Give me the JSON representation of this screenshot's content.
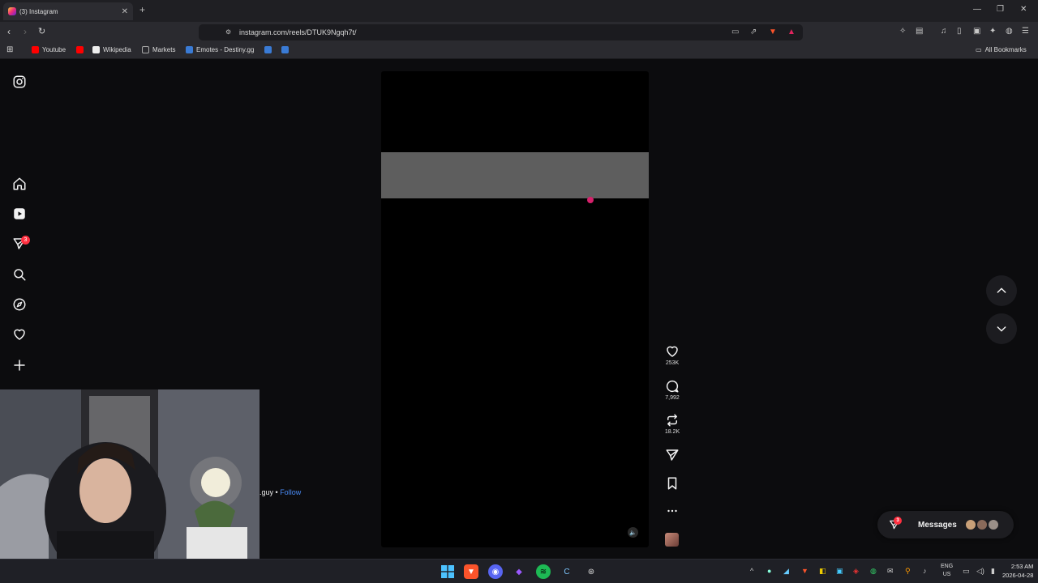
{
  "browser": {
    "tab_title": "(3) Instagram",
    "url": "instagram.com/reels/DTUK9Ngqh7t/",
    "bookmarks": [
      "Youtube",
      "Wikipedia",
      "Markets",
      "Emotes - Destiny.gg"
    ],
    "all_bookmarks": "All Bookmarks"
  },
  "instagram": {
    "notification_count": "3",
    "reel": {
      "likes": "253K",
      "comments": "7,992",
      "reposts": "18.2K"
    },
    "author_suffix": ".guy •",
    "follow_label": "Follow",
    "messages": {
      "label": "Messages",
      "badge": "3"
    }
  },
  "taskbar": {
    "lang_line1": "ENG",
    "lang_line2": "US",
    "time": "2:53 AM",
    "date": "2026-04-28"
  },
  "colors": {
    "accent_instagram": "#ff3040",
    "follow_link": "#4a8cf7",
    "reel_band": "#5e5e5e"
  }
}
